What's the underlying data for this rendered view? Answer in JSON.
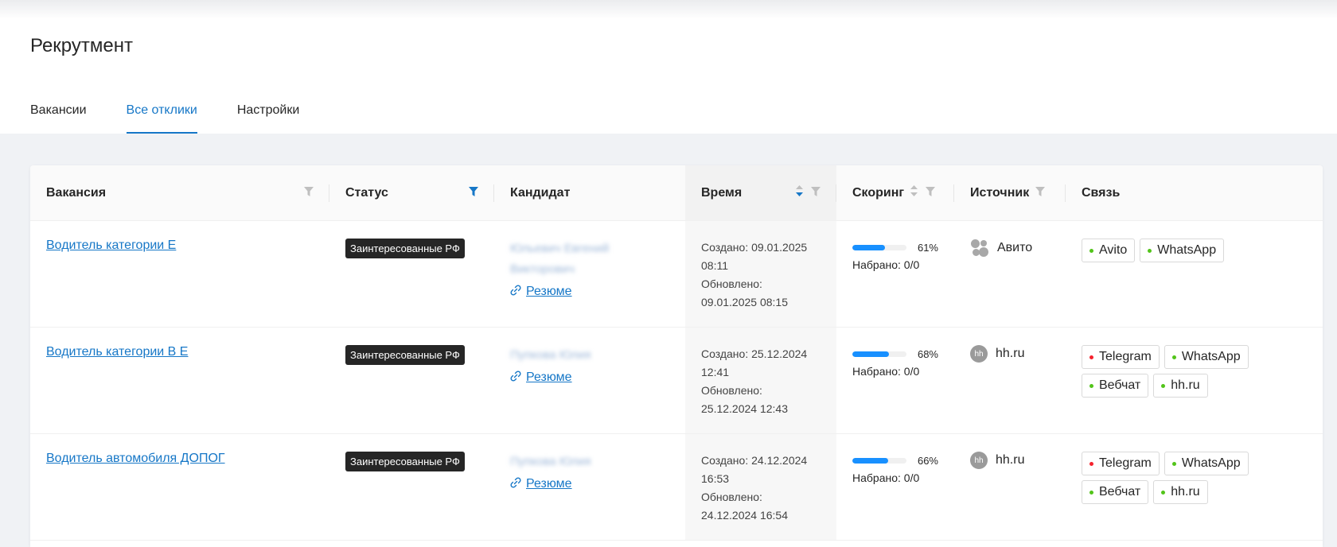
{
  "header": {
    "title": "Рекрутмент",
    "tabs": [
      {
        "label": "Вакансии",
        "active": false
      },
      {
        "label": "Все отклики",
        "active": true
      },
      {
        "label": "Настройки",
        "active": false
      }
    ]
  },
  "table": {
    "columns": {
      "vacancy": "Вакансия",
      "status": "Статус",
      "candidate": "Кандидат",
      "time": "Время",
      "scoring": "Скоринг",
      "source": "Источник",
      "contact": "Связь"
    },
    "rows": [
      {
        "vacancy": "Водитель категории Е",
        "status": "Заинтересованные РФ",
        "candidate_name": "Юльевич Евгений Викторович",
        "resume": "Резюме",
        "created_label": "Создано: 09.01.2025",
        "created_time": "08:11",
        "updated_label": "Обновлено:",
        "updated_value": "09.01.2025 08:15",
        "score_percent": 61,
        "score_label": "61%",
        "collected": "Набрано: 0/0",
        "source": "Авито",
        "source_icon": "avito-icon",
        "chips": [
          {
            "label": "Avito",
            "color": "#52c41a"
          },
          {
            "label": "WhatsApp",
            "color": "#52c41a"
          }
        ]
      },
      {
        "vacancy": "Водитель категории В Е",
        "status": "Заинтересованные РФ",
        "candidate_name": "Пупкова Юлия",
        "resume": "Резюме",
        "created_label": "Создано: 25.12.2024",
        "created_time": "12:41",
        "updated_label": "Обновлено:",
        "updated_value": "25.12.2024 12:43",
        "score_percent": 68,
        "score_label": "68%",
        "collected": "Набрано: 0/0",
        "source": "hh.ru",
        "source_icon": "hh-icon",
        "chips": [
          {
            "label": "Telegram",
            "color": "#f5222d"
          },
          {
            "label": "WhatsApp",
            "color": "#52c41a"
          },
          {
            "label": "Вебчат",
            "color": "#52c41a"
          },
          {
            "label": "hh.ru",
            "color": "#52c41a"
          }
        ]
      },
      {
        "vacancy": "Водитель автомобиля ДОПОГ",
        "status": "Заинтересованные РФ",
        "candidate_name": "Пупкова Юлия",
        "resume": "Резюме",
        "created_label": "Создано: 24.12.2024",
        "created_time": "16:53",
        "updated_label": "Обновлено:",
        "updated_value": "24.12.2024 16:54",
        "score_percent": 66,
        "score_label": "66%",
        "collected": "Набрано: 0/0",
        "source": "hh.ru",
        "source_icon": "hh-icon",
        "chips": [
          {
            "label": "Telegram",
            "color": "#f5222d"
          },
          {
            "label": "WhatsApp",
            "color": "#52c41a"
          },
          {
            "label": "Вебчат",
            "color": "#52c41a"
          },
          {
            "label": "hh.ru",
            "color": "#52c41a"
          }
        ]
      }
    ]
  },
  "colors": {
    "accent": "#1677c7",
    "bar": "#1890ff",
    "active_filter": "#1677c7",
    "inactive_icon": "#bfbfbf"
  }
}
